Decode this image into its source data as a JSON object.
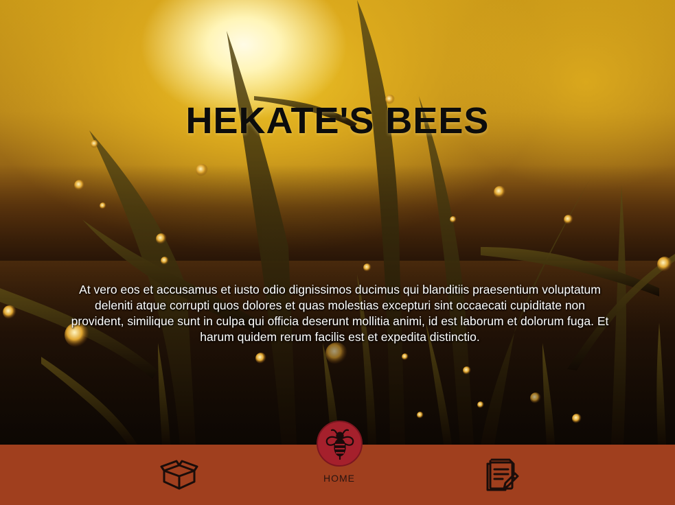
{
  "hero": {
    "title": "HEKATE'S BEES",
    "description": "At vero eos et accusamus et iusto odio dignissimos ducimus qui blanditiis praesentium voluptatum deleniti atque corrupti quos dolores et quas molestias excepturi sint occaecati cupiditate non provident, similique sunt in culpa qui officia deserunt mollitia animi, id est laborum et dolorum fuga. Et harum quidem rerum facilis est et expedita distinctio."
  },
  "nav": {
    "items": [
      {
        "icon": "box-icon"
      },
      {
        "label": "HOME",
        "icon": "bee-icon"
      },
      {
        "icon": "document-icon"
      }
    ]
  },
  "colors": {
    "navbar": "#a03f1e",
    "home_circle": "#a5202c",
    "title_text": "#0c0c0c",
    "description_text": "#ffffff",
    "icon_stroke": "#1a0d0a"
  }
}
